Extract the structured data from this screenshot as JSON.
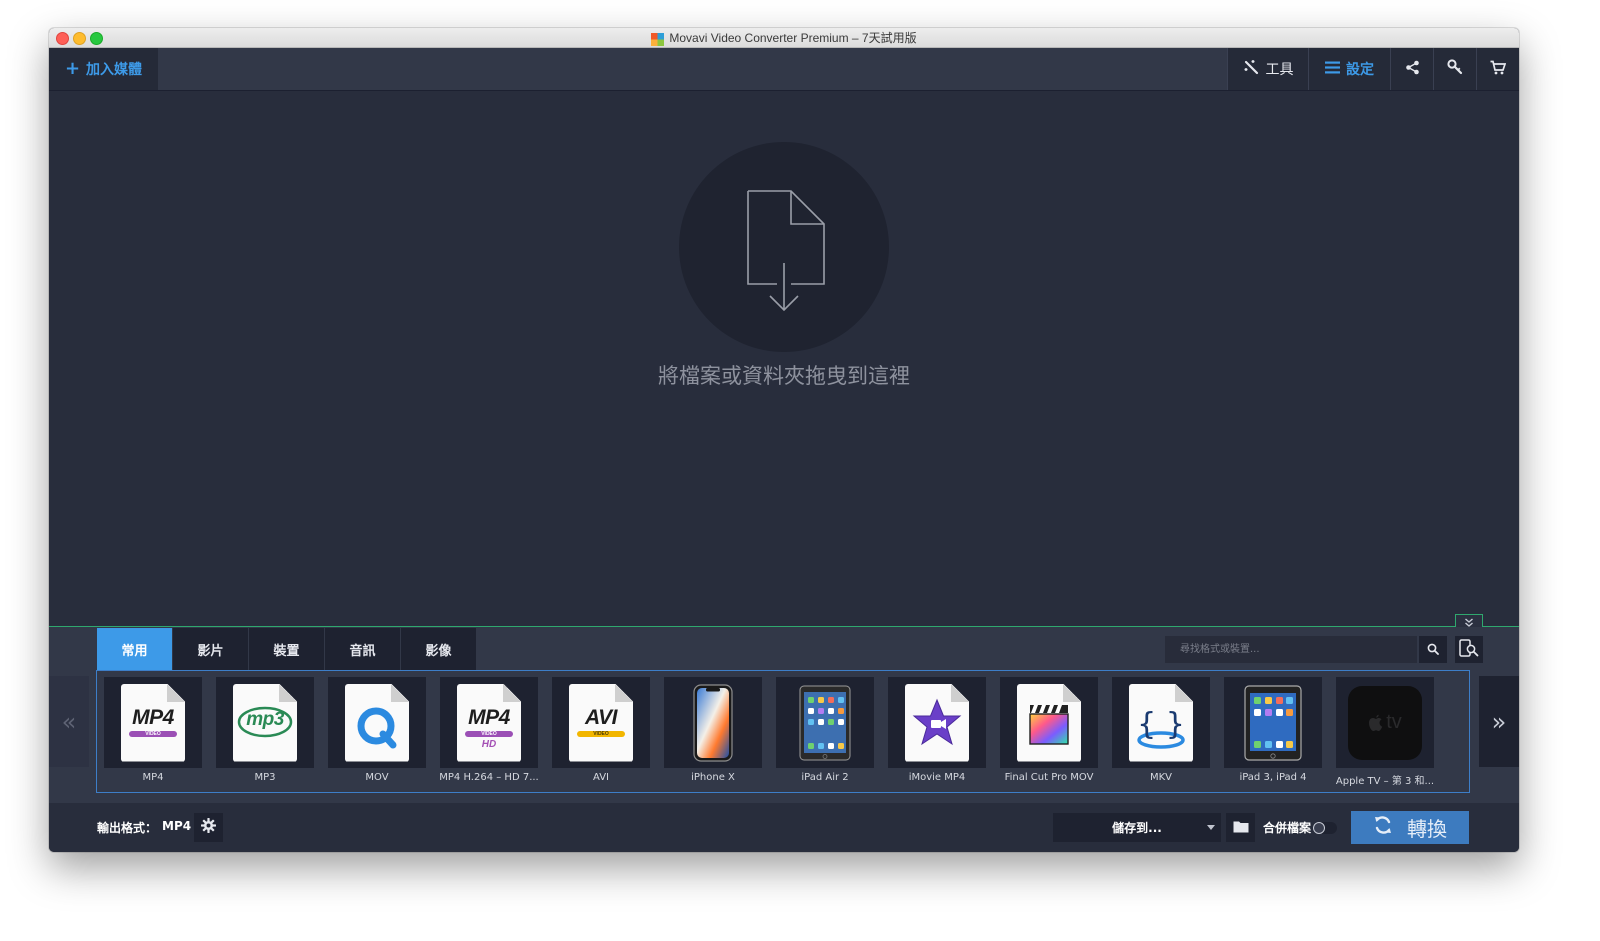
{
  "window": {
    "title": "Movavi Video Converter Premium – 7天試用版"
  },
  "toolbar": {
    "add_media_label": "加入媒體",
    "tools_label": "工具",
    "settings_label": "設定"
  },
  "dropzone": {
    "text": "將檔案或資料夾拖曳到這裡"
  },
  "tabs": [
    {
      "label": "常用",
      "active": true
    },
    {
      "label": "影片",
      "active": false
    },
    {
      "label": "裝置",
      "active": false
    },
    {
      "label": "音訊",
      "active": false
    },
    {
      "label": "影像",
      "active": false
    }
  ],
  "search": {
    "placeholder": "尋找格式或裝置..."
  },
  "presets": [
    {
      "label": "MP4",
      "icon": "mp4-file-icon",
      "badge": "MP4",
      "band": "VIDEO"
    },
    {
      "label": "MP3",
      "icon": "mp3-file-icon",
      "badge": "mp3"
    },
    {
      "label": "MOV",
      "icon": "quicktime-file-icon"
    },
    {
      "label": "MP4 H.264 – HD 7...",
      "icon": "mp4-hd-file-icon",
      "badge": "MP4",
      "band": "VIDEO",
      "sub": "HD"
    },
    {
      "label": "AVI",
      "icon": "avi-file-icon",
      "badge": "AVI",
      "band": "VIDEO"
    },
    {
      "label": "iPhone X",
      "icon": "iphone-icon"
    },
    {
      "label": "iPad Air 2",
      "icon": "ipad-icon"
    },
    {
      "label": "iMovie MP4",
      "icon": "imovie-icon"
    },
    {
      "label": "Final Cut Pro MOV",
      "icon": "final-cut-pro-icon"
    },
    {
      "label": "MKV",
      "icon": "mkv-file-icon"
    },
    {
      "label": "iPad 3, iPad 4",
      "icon": "ipad-classic-icon"
    },
    {
      "label": "Apple TV – 第 3 和...",
      "icon": "apple-tv-icon",
      "badge": "tv"
    }
  ],
  "bottom": {
    "output_format_label": "輸出格式：",
    "output_format_value": "MP4",
    "save_to_label": "儲存到...",
    "merge_label": "合併檔案",
    "convert_label": "轉換"
  },
  "colors": {
    "accent": "#3d9ae8",
    "panel_line": "#2fa86e",
    "background": "#282d3c",
    "convert": "#3d7bbf"
  }
}
